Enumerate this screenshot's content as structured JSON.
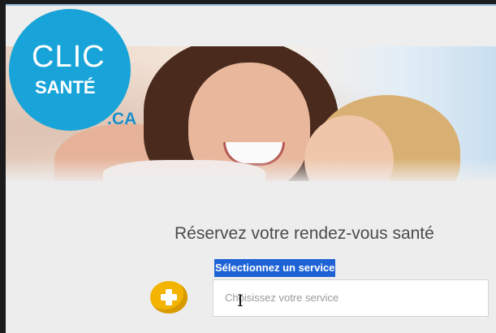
{
  "logo": {
    "line1": "CLIC",
    "line2": "SANTÉ",
    "suffix": ".CA"
  },
  "heading": "Réservez votre rendez-vous santé",
  "service": {
    "label": "Sélectionnez un service",
    "placeholder": "Choisissez votre service"
  },
  "colors": {
    "brand_blue": "#19a4d9",
    "selection_highlight": "#1e63d6",
    "plus_badge": "#f2b400"
  },
  "icons": {
    "service_icon": "plus-icon",
    "cursor": "text-cursor-icon"
  }
}
